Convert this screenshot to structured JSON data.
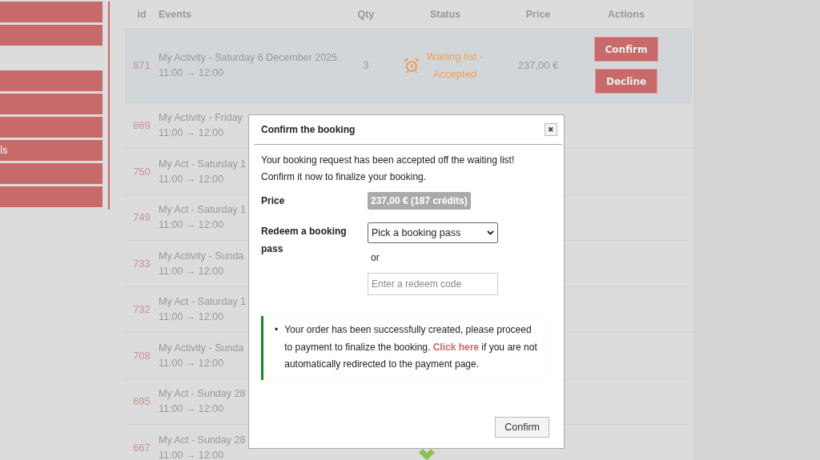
{
  "sidebar": {
    "groups": [
      {
        "items": [
          {
            "kind": "button"
          },
          {
            "kind": "button"
          }
        ]
      },
      {
        "items": [
          {
            "kind": "button"
          },
          {
            "kind": "button"
          },
          {
            "kind": "button"
          },
          {
            "kind": "button",
            "label": "ls"
          },
          {
            "kind": "button"
          },
          {
            "kind": "button"
          }
        ]
      }
    ]
  },
  "table": {
    "columns": [
      "id",
      "Events",
      "Qty",
      "Status",
      "Price",
      "Actions"
    ],
    "rows": [
      {
        "id": "871",
        "event": "My Activity - Saturday 6 December 2025",
        "time": "11:00 → 12:00",
        "qty": "3",
        "status": {
          "kind": "waiting",
          "label": "Waiting list - Accepted"
        },
        "price": "237,00 €",
        "actions": [
          "Confirm",
          "Decline"
        ],
        "selected": true
      },
      {
        "id": "869",
        "event": "My Activity - Friday",
        "time": "11:00 → 12:00",
        "selected": false
      },
      {
        "id": "750",
        "event": "My Act - Saturday 1",
        "time": "11:00 → 12:00",
        "selected": false
      },
      {
        "id": "749",
        "event": "My Act - Saturday 1",
        "time": "11:00 → 12:00",
        "selected": false
      },
      {
        "id": "733",
        "event": "My Activity - Sunda",
        "time": "11:00 → 12:00",
        "selected": false
      },
      {
        "id": "732",
        "event": "My Act - Saturday 1",
        "time": "11:00 → 12:00",
        "selected": false
      },
      {
        "id": "708",
        "event": "My Activity - Sunda",
        "time": "11:00 → 12:00",
        "selected": false
      },
      {
        "id": "695",
        "event": "My Act - Sunday 28",
        "time": "11:00 → 12:00",
        "selected": false
      },
      {
        "id": "667",
        "event": "My Act - Sunday 28",
        "time": "11:00 → 12:00",
        "status": {
          "kind": "booked"
        },
        "selected": false
      }
    ]
  },
  "modal": {
    "title": "Confirm the booking",
    "close": "✖",
    "intro": [
      "Your booking request has been accepted off the waiting list!",
      "Confirm it now to finalize your booking."
    ],
    "price_label": "Price",
    "price": "237,00 € (187 crédits)",
    "redeem_label": "Redeem a booking pass",
    "pass_select": "Pick a booking pass",
    "or": "or",
    "code_placeholder": "Enter a redeem code",
    "alert": {
      "bullet": "•",
      "before": "Your order has been successfully created, please proceed to payment to finalize the booking.",
      "link": "Click here",
      "after": "if you are not automatically redirected to the payment page."
    },
    "confirm": "Confirm"
  }
}
